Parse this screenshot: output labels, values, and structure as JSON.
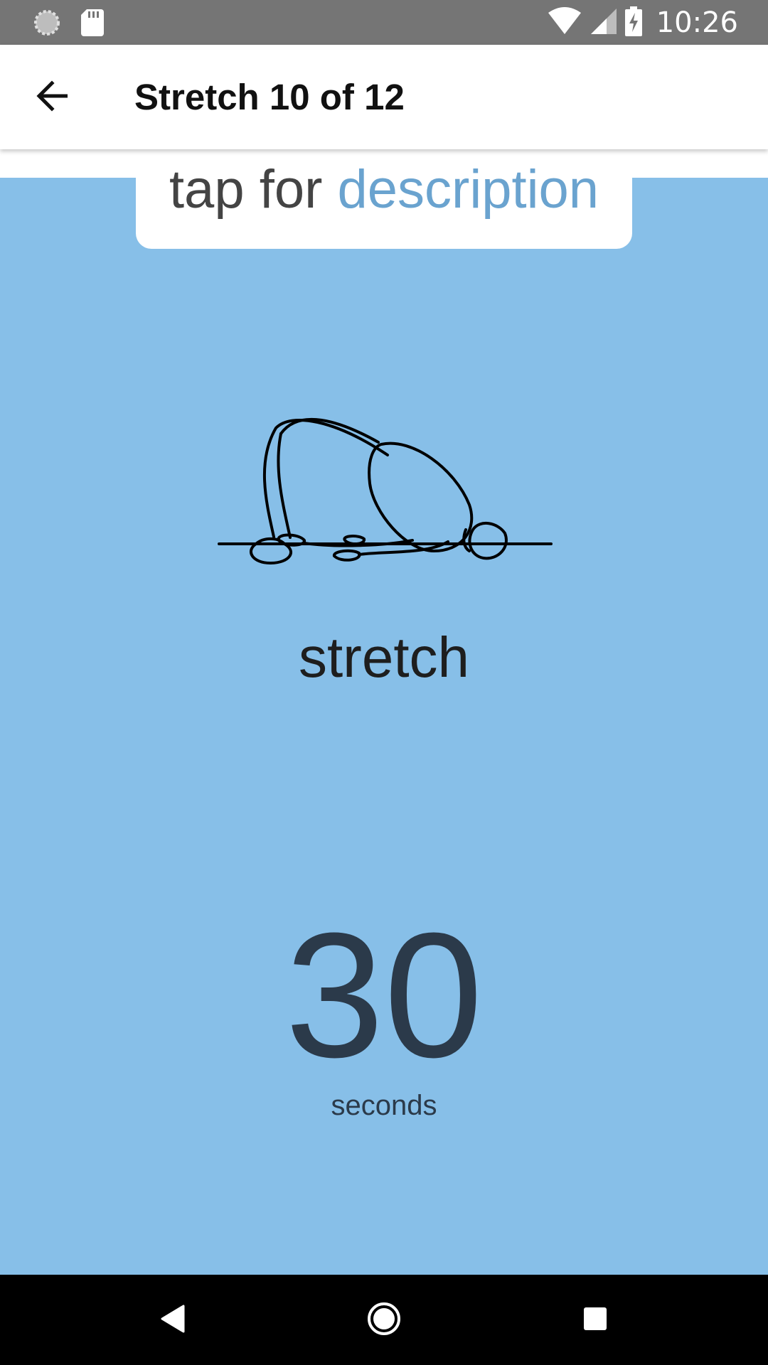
{
  "status_bar": {
    "time": "10:26",
    "icons": [
      "sync-icon",
      "sd-card-icon",
      "wifi-icon",
      "signal-icon",
      "battery-charging-icon"
    ]
  },
  "app_bar": {
    "title": "Stretch 10 of 12",
    "back_icon": "arrow-back-icon"
  },
  "description_card": {
    "prefix": "tap for ",
    "link": "description"
  },
  "exercise": {
    "name": "stretch",
    "illustration": "stretch-figure-icon"
  },
  "timer": {
    "value": "30",
    "unit": "seconds"
  },
  "nav_bar": {
    "icons": [
      "nav-back-icon",
      "nav-home-icon",
      "nav-recents-icon"
    ]
  },
  "colors": {
    "status_bar": "#757575",
    "background": "#87bfe8",
    "link": "#6aa3cf",
    "timer": "#2b3a4a"
  }
}
